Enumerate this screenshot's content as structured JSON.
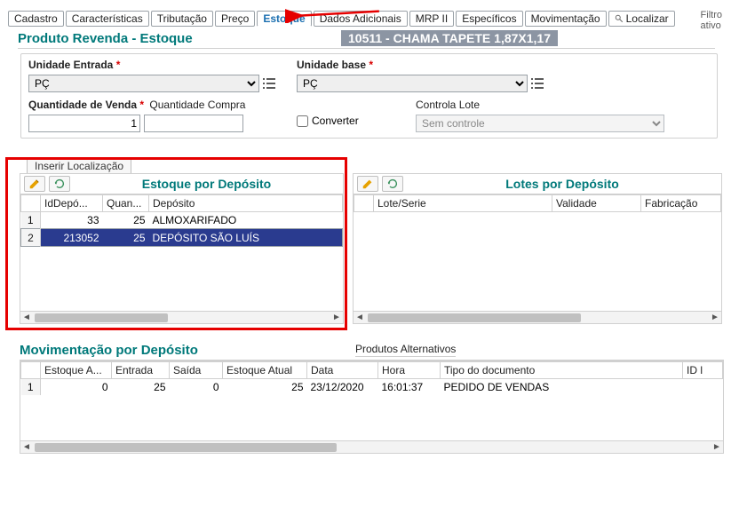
{
  "filtro_label": "Filtro\nativo",
  "tabs": [
    "Cadastro",
    "Características",
    "Tributação",
    "Preço",
    "Estoque",
    "Dados Adicionais",
    "MRP II",
    "Específicos",
    "Movimentação",
    "Localizar"
  ],
  "active_tab_index": 4,
  "subtitle_left": "Produto Revenda - Estoque",
  "subtitle_right": "10511 - CHAMA TAPETE 1,87X1,17",
  "form": {
    "unidade_entrada_label": "Unidade Entrada",
    "unidade_entrada_value": "PÇ",
    "unidade_base_label": "Unidade base",
    "unidade_base_value": "PÇ",
    "qtd_venda_label": "Quantidade de Venda",
    "qtd_venda_value": "1",
    "qtd_compra_label": "Quantidade Compra",
    "qtd_compra_value": "",
    "converter_label": "Converter",
    "controla_lote_label": "Controla Lote",
    "controla_lote_value": "Sem controle"
  },
  "inserir_local_btn": "Inserir Localização",
  "left_panel_title": "Estoque por Depósito",
  "right_panel_title": "Lotes por Depósito",
  "left_cols": [
    "",
    "IdDepó...",
    "Quan...",
    "Depósito"
  ],
  "left_rows": [
    {
      "n": "1",
      "id": "33",
      "q": "25",
      "dep": "ALMOXARIFADO"
    },
    {
      "n": "2",
      "id": "213052",
      "q": "25",
      "dep": "DEPÓSITO SÃO LUÍS"
    }
  ],
  "right_cols": [
    "",
    "Lote/Serie",
    "Validade",
    "Fabricação"
  ],
  "mov_title": "Movimentação por Depósito",
  "prod_alt_label": "Produtos Alternativos",
  "mov_cols": [
    "",
    "Estoque A...",
    "Entrada",
    "Saída",
    "Estoque Atual",
    "Data",
    "Hora",
    "Tipo do documento",
    "ID l"
  ],
  "mov_rows": [
    {
      "n": "1",
      "ea": "0",
      "ent": "25",
      "sai": "0",
      "atu": "25",
      "data": "23/12/2020",
      "hora": "16:01:37",
      "tipo": "PEDIDO DE VENDAS",
      "id": ""
    }
  ],
  "req_star": "*"
}
